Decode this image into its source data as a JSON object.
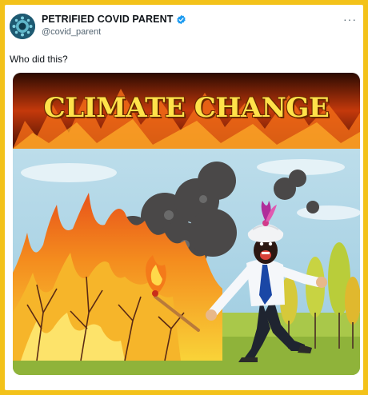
{
  "post": {
    "author_name": "PETRIFIED COVID PARENT",
    "author_handle": "@covid_parent",
    "verified": true,
    "more_icon": "ellipsis-icon",
    "text": "Who did this?"
  },
  "media": {
    "headline": "CLIMATE CHANGE"
  },
  "colors": {
    "frame_border": "#f3c21a",
    "verified_badge": "#1d9bf0",
    "headline_text": "#ffe24a"
  }
}
